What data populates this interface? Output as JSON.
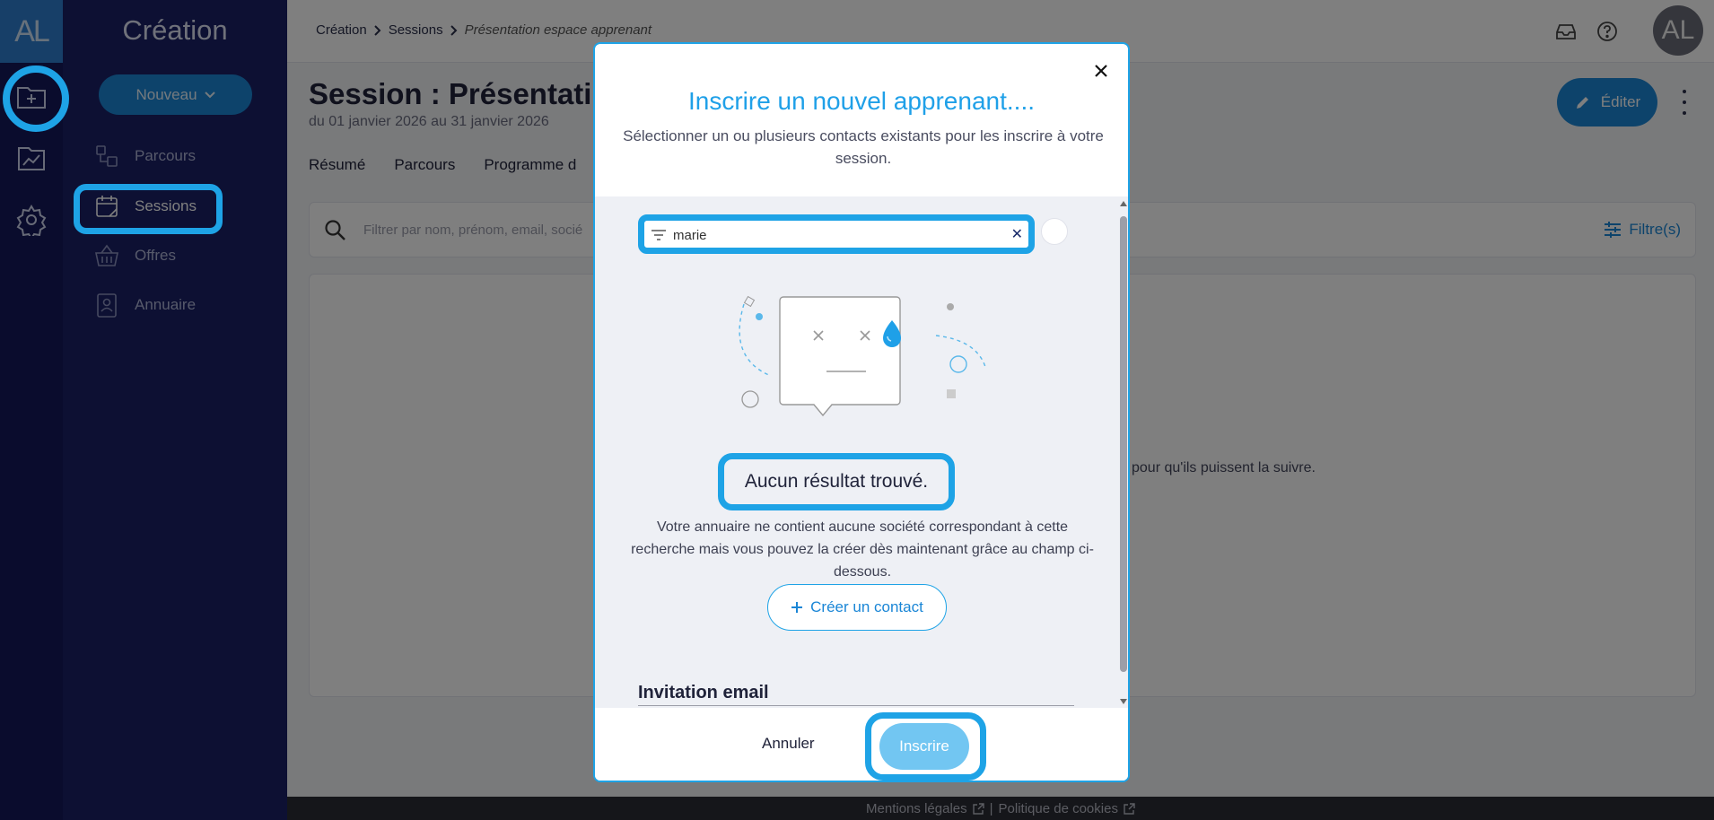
{
  "app": {
    "logo_text": "AL",
    "section_title": "Création",
    "accent_color": "#1ea3e6",
    "sidebar_color": "#1a2066"
  },
  "rail": {
    "icons": [
      "folder-plus-icon",
      "chart-icon",
      "gear-icon"
    ]
  },
  "nav": {
    "new_button_label": "Nouveau",
    "items": [
      {
        "label": "Parcours",
        "icon": "workflow-icon"
      },
      {
        "label": "Sessions",
        "icon": "calendar-icon",
        "active": true
      },
      {
        "label": "Offres",
        "icon": "basket-icon"
      },
      {
        "label": "Annuaire",
        "icon": "contact-book-icon"
      }
    ]
  },
  "topbar": {
    "breadcrumb": [
      "Création",
      "Sessions",
      "Présentation espace apprenant"
    ],
    "avatar_initials": "AL"
  },
  "page": {
    "title": "Session : Présentati",
    "dates": "du 01 janvier 2026 au 31 janvier 2026",
    "edit_label": "Éditer",
    "tabs": [
      "Résumé",
      "Parcours",
      "Programme d"
    ],
    "filter_placeholder": "Filtrer par nom, prénom, email, socié",
    "filters_label": "Filtre(s)",
    "empty_text": "pour qu'ils puissent la suivre."
  },
  "footer": {
    "legal": "Mentions légales",
    "separator": "|",
    "cookies": "Politique de cookies"
  },
  "modal": {
    "title": "Inscrire un nouvel apprenant....",
    "subtitle": "Sélectionner un ou plusieurs contacts existants pour les inscrire à votre session.",
    "search_value": "marie",
    "no_result_title": "Aucun résultat trouvé.",
    "no_result_desc": "Votre annuaire ne contient aucune société correspondant à cette recherche mais vous pouvez la créer dès maintenant grâce au champ ci-dessous.",
    "create_contact_label": "Créer un contact",
    "invite_title": "Invitation email",
    "cancel_label": "Annuler",
    "submit_label": "Inscrire"
  }
}
